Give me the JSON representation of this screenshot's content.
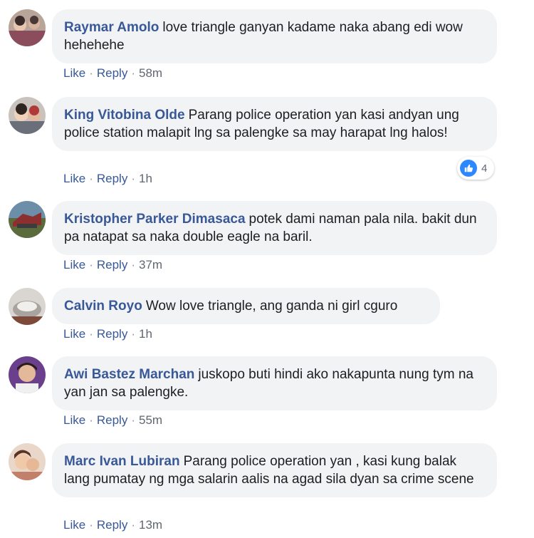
{
  "comments": [
    {
      "author": "Raymar Amolo",
      "text": "love triangle ganyan kadame naka abang edi wow hehehehe",
      "actions": {
        "like": "Like",
        "reply": "Reply",
        "time": "58m"
      }
    },
    {
      "author": "King Vitobina Olde",
      "text": "Parang police operation yan kasi andyan ung police station malapit lng sa palengke sa may harapat lng halos!",
      "actions": {
        "like": "Like",
        "reply": "Reply",
        "time": "1h"
      },
      "reactions": {
        "icon": "like-icon",
        "count": "4",
        "color": "#2d88ff"
      }
    },
    {
      "author": "Kristopher Parker Dimasaca",
      "text": "potek dami naman pala nila. bakit dun pa natapat sa naka double eagle na baril.",
      "actions": {
        "like": "Like",
        "reply": "Reply",
        "time": "37m"
      }
    },
    {
      "author": "Calvin Royo",
      "text": "Wow love triangle, ang ganda ni girl cguro",
      "actions": {
        "like": "Like",
        "reply": "Reply",
        "time": "1h"
      }
    },
    {
      "author": "Awi Bastez Marchan",
      "text": "juskopo buti hindi ako nakapunta nung tym na yan jan sa palengke.",
      "actions": {
        "like": "Like",
        "reply": "Reply",
        "time": "55m"
      }
    },
    {
      "author": "Marc Ivan Lubiran",
      "text": "Parang police operation yan , kasi kung balak lang pumatay ng mga salarin aalis na agad sila dyan sa crime scene",
      "actions": {
        "like": "Like",
        "reply": "Reply",
        "time": "13m"
      }
    }
  ],
  "colors": {
    "author": "#385898",
    "bubble": "#f2f3f5",
    "meta": "#606770"
  }
}
